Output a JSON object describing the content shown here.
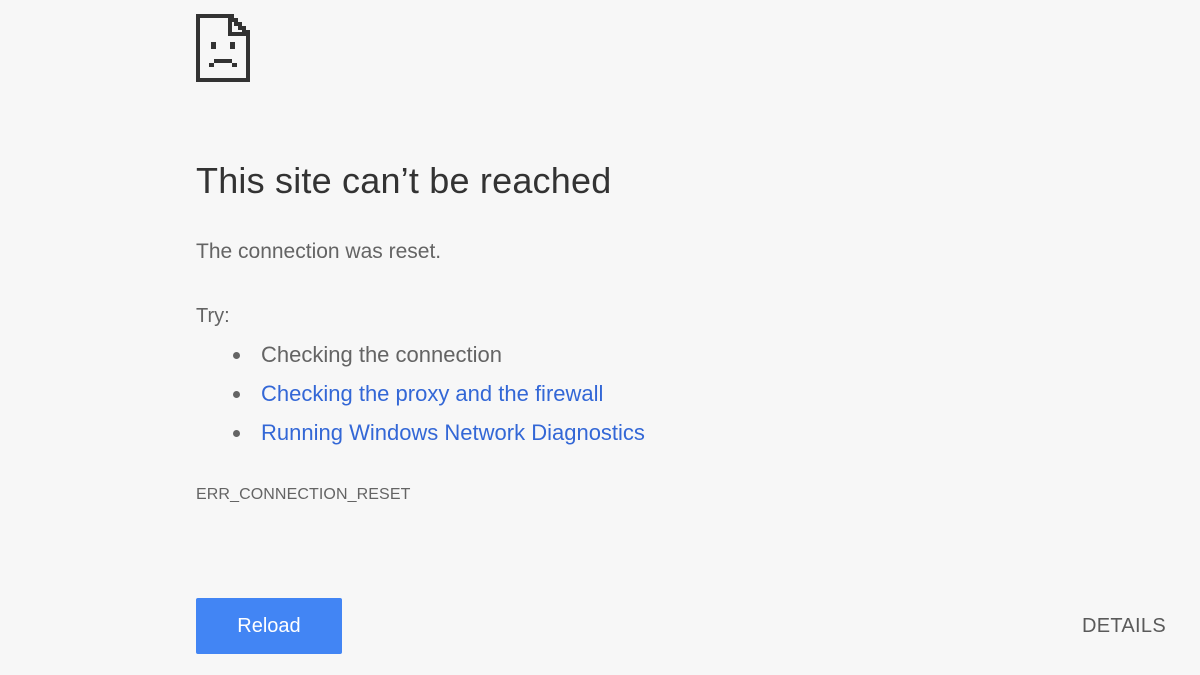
{
  "icon": {
    "name": "sad-page-icon"
  },
  "main": {
    "heading": "This site can’t be reached",
    "message": "The connection was reset.",
    "try_label": "Try:",
    "suggestions": [
      {
        "text": "Checking the connection",
        "is_link": false
      },
      {
        "text": "Checking the proxy and the firewall",
        "is_link": true
      },
      {
        "text": "Running Windows Network Diagnostics",
        "is_link": true
      }
    ],
    "error_code": "ERR_CONNECTION_RESET"
  },
  "actions": {
    "reload_label": "Reload",
    "details_label": "DETAILS"
  },
  "colors": {
    "background": "#f7f7f7",
    "heading": "#333333",
    "body_text": "#646464",
    "link": "#3367d6",
    "primary_button": "#4285f4",
    "primary_button_text": "#ffffff"
  }
}
